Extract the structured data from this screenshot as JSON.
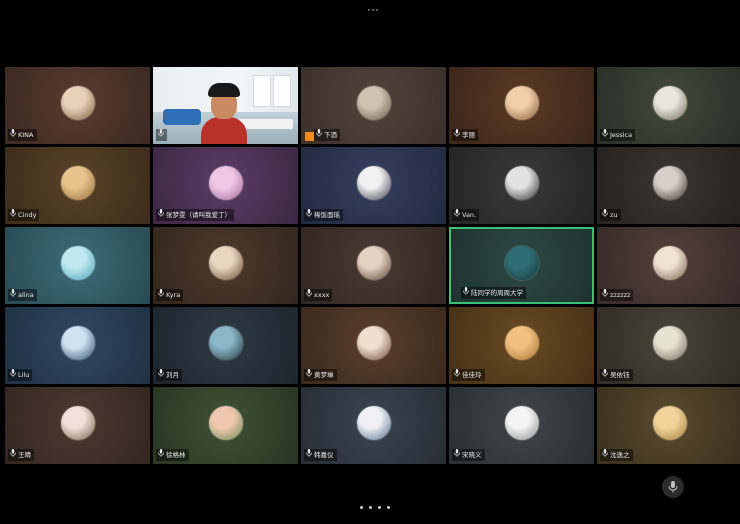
{
  "meeting": {
    "mic_icon": "microphone-icon",
    "pages": 4,
    "bottom_control": {
      "icon": "microphone-icon"
    }
  },
  "tiles": [
    {
      "name": "KINA",
      "bg": [
        "#5a3a2e",
        "#3b2a22"
      ],
      "avatar": [
        "#e9d3b8",
        "#7a5a40"
      ],
      "row": 0,
      "col": 0
    },
    {
      "name": "",
      "bg": [
        "#cfdde6",
        "#9fb1bb"
      ],
      "avatar": [
        "#000000",
        "#000000"
      ],
      "row": 0,
      "col": 1,
      "video": true
    },
    {
      "name": "下酒",
      "bg": [
        "#53443a",
        "#3a302a"
      ],
      "avatar": [
        "#cfc2b0",
        "#6a5a48"
      ],
      "row": 0,
      "col": 2
    },
    {
      "name": "李丽",
      "bg": [
        "#5c3a24",
        "#3a261a"
      ],
      "avatar": [
        "#f0d0a8",
        "#8a5a36"
      ],
      "row": 0,
      "col": 3
    },
    {
      "name": "Jessica",
      "bg": [
        "#43493a",
        "#2a2e26"
      ],
      "avatar": [
        "#e8e6d8",
        "#6e6a58"
      ],
      "row": 0,
      "col": 4
    },
    {
      "name": "Cindy",
      "bg": [
        "#5a4327",
        "#3b2c1a"
      ],
      "avatar": [
        "#e7c48c",
        "#946a38"
      ],
      "row": 1,
      "col": 0
    },
    {
      "name": "张梦雯（请叫我爱丁）",
      "bg": [
        "#5b3d66",
        "#3b2743"
      ],
      "avatar": [
        "#f0c8e6",
        "#a06a98"
      ],
      "row": 1,
      "col": 1
    },
    {
      "name": "稀饭面瑶",
      "bg": [
        "#34405e",
        "#222a40"
      ],
      "avatar": [
        "#f0f0f0",
        "#3a3a4a"
      ],
      "row": 1,
      "col": 2
    },
    {
      "name": "Van.",
      "bg": [
        "#393939",
        "#242424"
      ],
      "avatar": [
        "#e2e2e2",
        "#2a2a2a"
      ],
      "row": 1,
      "col": 3
    },
    {
      "name": "zu",
      "bg": [
        "#3c3530",
        "#26211d"
      ],
      "avatar": [
        "#d8cfc8",
        "#3a3028"
      ],
      "row": 1,
      "col": 4
    },
    {
      "name": "alina",
      "bg": [
        "#3d6d79",
        "#284a53"
      ],
      "avatar": [
        "#bfe8f0",
        "#4aa2b8"
      ],
      "row": 2,
      "col": 0
    },
    {
      "name": "Kyra",
      "bg": [
        "#4e3a2c",
        "#33261d"
      ],
      "avatar": [
        "#e8d6c0",
        "#6a4a30"
      ],
      "row": 2,
      "col": 1
    },
    {
      "name": "xxxx",
      "bg": [
        "#4a3b33",
        "#302620"
      ],
      "avatar": [
        "#e6d2c2",
        "#5a4030"
      ],
      "row": 2,
      "col": 2
    },
    {
      "name": "陆同学的周周大学",
      "bg": [
        "#2d4a44",
        "#1e322e"
      ],
      "avatar": [
        "#2e6d74",
        "#183a40"
      ],
      "row": 2,
      "col": 3,
      "active": true
    },
    {
      "name": "zzzzzz",
      "bg": [
        "#54403a",
        "#372a26"
      ],
      "avatar": [
        "#f0e2d2",
        "#7a5a48"
      ],
      "row": 2,
      "col": 4
    },
    {
      "name": "Lilu",
      "bg": [
        "#304a63",
        "#1f3042"
      ],
      "avatar": [
        "#cfe2f0",
        "#2a4a6a"
      ],
      "row": 3,
      "col": 0
    },
    {
      "name": "刘月",
      "bg": [
        "#2f3a44",
        "#1d252c"
      ],
      "avatar": [
        "#8ab6c8",
        "#23343e"
      ],
      "row": 3,
      "col": 1
    },
    {
      "name": "黄梦琳",
      "bg": [
        "#5a3f2a",
        "#3a291c"
      ],
      "avatar": [
        "#f0dfcf",
        "#6a4a34"
      ],
      "row": 3,
      "col": 2
    },
    {
      "name": "佳佳玲",
      "bg": [
        "#6a4a22",
        "#453016"
      ],
      "avatar": [
        "#f2c080",
        "#a0702e"
      ],
      "row": 3,
      "col": 3
    },
    {
      "name": "吴依钰",
      "bg": [
        "#4a4438",
        "#302c24"
      ],
      "avatar": [
        "#e8e2d2",
        "#6a6050"
      ],
      "row": 3,
      "col": 4
    },
    {
      "name": "王晴",
      "bg": [
        "#4e3a30",
        "#33261f"
      ],
      "avatar": [
        "#f0e0d8",
        "#7a5a48"
      ],
      "row": 4,
      "col": 0
    },
    {
      "name": "徐格林",
      "bg": [
        "#3f5235",
        "#283522"
      ],
      "avatar": [
        "#f0c8b0",
        "#6a8a52"
      ],
      "row": 4,
      "col": 1
    },
    {
      "name": "韩嘉仪",
      "bg": [
        "#3a4550",
        "#262d34"
      ],
      "avatar": [
        "#f0f0f4",
        "#4a6a8a"
      ],
      "row": 4,
      "col": 2
    },
    {
      "name": "宋晓义",
      "bg": [
        "#40464c",
        "#2a2e32"
      ],
      "avatar": [
        "#f4f4f4",
        "#8a8a8a"
      ],
      "row": 4,
      "col": 3
    },
    {
      "name": "沈逸之",
      "bg": [
        "#5a4a2e",
        "#3b301d"
      ],
      "avatar": [
        "#f2d49a",
        "#a07a3a"
      ],
      "row": 4,
      "col": 4
    }
  ]
}
